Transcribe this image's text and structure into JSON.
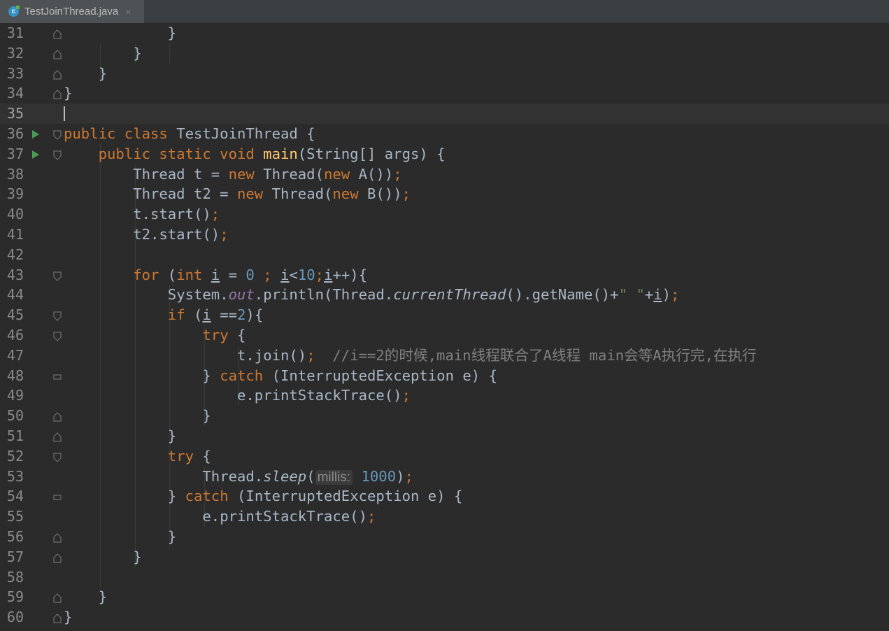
{
  "tab": {
    "file_name": "TestJoinThread.java",
    "icon": "java-class-icon",
    "close": "×"
  },
  "editor": {
    "current_line": 35,
    "run_lines": [
      36,
      37
    ],
    "lines": [
      {
        "n": "31",
        "indent": 3,
        "fold": "end",
        "tokens": [
          {
            "t": "}"
          }
        ]
      },
      {
        "n": "32",
        "indent": 2,
        "fold": "end",
        "tokens": [
          {
            "t": "}"
          }
        ]
      },
      {
        "n": "33",
        "indent": 1,
        "fold": "end",
        "tokens": [
          {
            "t": "}"
          }
        ]
      },
      {
        "n": "34",
        "indent": 0,
        "fold": "end",
        "tokens": [
          {
            "t": "}"
          }
        ]
      },
      {
        "n": "35",
        "indent": 0,
        "fold": "",
        "tokens": []
      },
      {
        "n": "36",
        "indent": 0,
        "fold": "start",
        "tokens": [
          {
            "t": "public class ",
            "c": "kw"
          },
          {
            "t": "TestJoinThread {"
          }
        ]
      },
      {
        "n": "37",
        "indent": 1,
        "fold": "start",
        "tokens": [
          {
            "t": "public static void ",
            "c": "kw"
          },
          {
            "t": "main",
            "c": "fn"
          },
          {
            "t": "(String[] args) {"
          }
        ]
      },
      {
        "n": "38",
        "indent": 2,
        "fold": "",
        "tokens": [
          {
            "t": "Thread t = "
          },
          {
            "t": "new ",
            "c": "kw"
          },
          {
            "t": "Thread("
          },
          {
            "t": "new ",
            "c": "kw"
          },
          {
            "t": "A())"
          },
          {
            "t": ";",
            "c": "kw"
          }
        ]
      },
      {
        "n": "39",
        "indent": 2,
        "fold": "",
        "tokens": [
          {
            "t": "Thread t2 = "
          },
          {
            "t": "new ",
            "c": "kw"
          },
          {
            "t": "Thread("
          },
          {
            "t": "new ",
            "c": "kw"
          },
          {
            "t": "B())"
          },
          {
            "t": ";",
            "c": "kw"
          }
        ]
      },
      {
        "n": "40",
        "indent": 2,
        "fold": "",
        "tokens": [
          {
            "t": "t.start()"
          },
          {
            "t": ";",
            "c": "kw"
          }
        ]
      },
      {
        "n": "41",
        "indent": 2,
        "fold": "",
        "tokens": [
          {
            "t": "t2.start()"
          },
          {
            "t": ";",
            "c": "kw"
          }
        ]
      },
      {
        "n": "42",
        "indent": 0,
        "fold": "",
        "tokens": []
      },
      {
        "n": "43",
        "indent": 2,
        "fold": "start",
        "tokens": [
          {
            "t": "for ",
            "c": "kw"
          },
          {
            "t": "("
          },
          {
            "t": "int ",
            "c": "kw"
          },
          {
            "t": "i",
            "c": "ul"
          },
          {
            "t": " = "
          },
          {
            "t": "0",
            "c": "num"
          },
          {
            "t": " ; ",
            "c": "kw"
          },
          {
            "t": "i",
            "c": "ul"
          },
          {
            "t": "<"
          },
          {
            "t": "10",
            "c": "num"
          },
          {
            "t": ";",
            "c": "kw"
          },
          {
            "t": "i",
            "c": "ul"
          },
          {
            "t": "++){"
          }
        ]
      },
      {
        "n": "44",
        "indent": 3,
        "fold": "",
        "tokens": [
          {
            "t": "System."
          },
          {
            "t": "out",
            "c": "fld"
          },
          {
            "t": ".println(Thread."
          },
          {
            "t": "currentThread",
            "c": "it"
          },
          {
            "t": "().getName()+"
          },
          {
            "t": "\" \"",
            "c": "str"
          },
          {
            "t": "+"
          },
          {
            "t": "i",
            "c": "ul"
          },
          {
            "t": ")"
          },
          {
            "t": ";",
            "c": "kw"
          }
        ]
      },
      {
        "n": "45",
        "indent": 3,
        "fold": "start",
        "tokens": [
          {
            "t": "if ",
            "c": "kw"
          },
          {
            "t": "("
          },
          {
            "t": "i",
            "c": "ul"
          },
          {
            "t": " =="
          },
          {
            "t": "2",
            "c": "num"
          },
          {
            "t": "){"
          }
        ]
      },
      {
        "n": "46",
        "indent": 4,
        "fold": "start",
        "tokens": [
          {
            "t": "try ",
            "c": "kw"
          },
          {
            "t": "{"
          }
        ]
      },
      {
        "n": "47",
        "indent": 5,
        "fold": "",
        "tokens": [
          {
            "t": "t.join()"
          },
          {
            "t": ";",
            "c": "kw"
          },
          {
            "t": "  //i==2的时候,main线程联合了A线程 main会等A执行完,在执行",
            "c": "cm"
          }
        ]
      },
      {
        "n": "48",
        "indent": 4,
        "fold": "mid",
        "tokens": [
          {
            "t": "} "
          },
          {
            "t": "catch ",
            "c": "kw"
          },
          {
            "t": "(InterruptedException e) {"
          }
        ]
      },
      {
        "n": "49",
        "indent": 5,
        "fold": "",
        "tokens": [
          {
            "t": "e.printStackTrace()"
          },
          {
            "t": ";",
            "c": "kw"
          }
        ]
      },
      {
        "n": "50",
        "indent": 4,
        "fold": "end",
        "tokens": [
          {
            "t": "}"
          }
        ]
      },
      {
        "n": "51",
        "indent": 3,
        "fold": "end",
        "tokens": [
          {
            "t": "}"
          }
        ]
      },
      {
        "n": "52",
        "indent": 3,
        "fold": "start",
        "tokens": [
          {
            "t": "try ",
            "c": "kw"
          },
          {
            "t": "{"
          }
        ]
      },
      {
        "n": "53",
        "indent": 4,
        "fold": "",
        "tokens": [
          {
            "t": "Thread."
          },
          {
            "t": "sleep",
            "c": "it"
          },
          {
            "t": "("
          },
          {
            "t": "millis:",
            "c": "hint"
          },
          {
            "t": " "
          },
          {
            "t": "1000",
            "c": "num"
          },
          {
            "t": ")"
          },
          {
            "t": ";",
            "c": "kw"
          }
        ]
      },
      {
        "n": "54",
        "indent": 3,
        "fold": "mid",
        "tokens": [
          {
            "t": "} "
          },
          {
            "t": "catch ",
            "c": "kw"
          },
          {
            "t": "(InterruptedException e) {"
          }
        ]
      },
      {
        "n": "55",
        "indent": 4,
        "fold": "",
        "tokens": [
          {
            "t": "e.printStackTrace()"
          },
          {
            "t": ";",
            "c": "kw"
          }
        ]
      },
      {
        "n": "56",
        "indent": 3,
        "fold": "end",
        "tokens": [
          {
            "t": "}"
          }
        ]
      },
      {
        "n": "57",
        "indent": 2,
        "fold": "end",
        "tokens": [
          {
            "t": "}"
          }
        ]
      },
      {
        "n": "58",
        "indent": 0,
        "fold": "",
        "tokens": []
      },
      {
        "n": "59",
        "indent": 1,
        "fold": "end",
        "tokens": [
          {
            "t": "}"
          }
        ]
      },
      {
        "n": "60",
        "indent": 0,
        "fold": "end",
        "tokens": [
          {
            "t": "}"
          }
        ]
      }
    ]
  }
}
